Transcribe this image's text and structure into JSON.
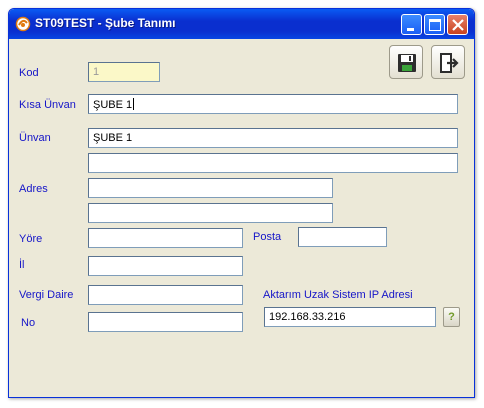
{
  "window": {
    "title": "ST09TEST - Şube Tanımı",
    "icons": {
      "app": "app-logo-icon",
      "minimize": "minimize-icon",
      "maximize": "maximize-icon",
      "close": "close-icon"
    }
  },
  "toolbar": {
    "save_icon": "save-disk-icon",
    "exit_icon": "exit-door-icon"
  },
  "form": {
    "kod": {
      "label": "Kod",
      "value": "1"
    },
    "kisa_unvan": {
      "label": "Kısa Ünvan",
      "value": "ŞUBE 1"
    },
    "unvan": {
      "label": "Ünvan",
      "line1": "ŞUBE 1",
      "line2": ""
    },
    "adres": {
      "label": "Adres",
      "line1": "",
      "line2": ""
    },
    "yore": {
      "label": "Yöre",
      "value": ""
    },
    "posta": {
      "label": "Posta",
      "value": ""
    },
    "il": {
      "label": "İl",
      "value": ""
    },
    "vergi_daire": {
      "label": "Vergi Daire",
      "value": ""
    },
    "no": {
      "label": "No",
      "value": ""
    },
    "aktarim": {
      "label": "Aktarım Uzak Sistem IP Adresi",
      "value": "192.168.33.216",
      "help_label": "?"
    }
  }
}
